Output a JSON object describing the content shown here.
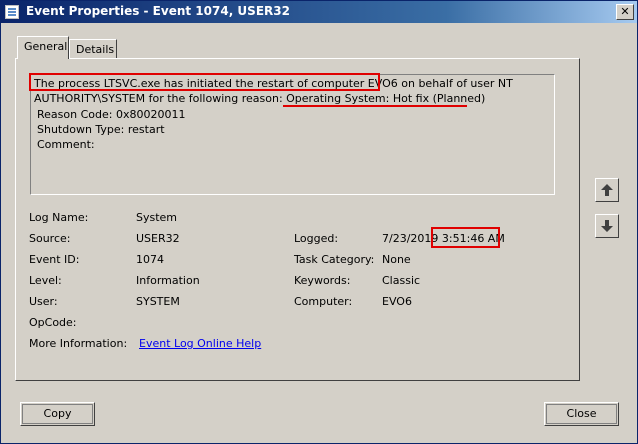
{
  "window": {
    "title": "Event Properties - Event 1074, USER32",
    "close_label": "✕"
  },
  "tabs": [
    {
      "label": "General",
      "active": true
    },
    {
      "label": "Details",
      "active": false
    }
  ],
  "message": {
    "line1_highlight": "The process LTSVC.exe has initiated the restart of computer EVO6",
    "line1_rest": " on behalf of user NT",
    "line2_prefix": "AUTHORITY\\SYSTEM for the following reason: ",
    "line2_reason": "Operating System: Hot fix (Planned)",
    "line3": "Reason Code: 0x80020011",
    "line4": "Shutdown Type: restart",
    "line5": "Comment:"
  },
  "fields": {
    "log_name_label": "Log Name:",
    "log_name_value": "System",
    "source_label": "Source:",
    "source_value": "USER32",
    "logged_label": "Logged:",
    "logged_date": "7/23/2019",
    "logged_time": "3:51:46 AM",
    "event_id_label": "Event ID:",
    "event_id_value": "1074",
    "task_category_label": "Task Category:",
    "task_category_value": "None",
    "level_label": "Level:",
    "level_value": "Information",
    "keywords_label": "Keywords:",
    "keywords_value": "Classic",
    "user_label": "User:",
    "user_value": "SYSTEM",
    "computer_label": "Computer:",
    "computer_value": "EVO6",
    "opcode_label": "OpCode:",
    "opcode_value": "",
    "more_info_label": "More Information:",
    "more_info_link": "Event Log Online Help"
  },
  "buttons": {
    "copy": "Copy",
    "close": "Close"
  },
  "icons": {
    "up": "arrow-up-icon",
    "down": "arrow-down-icon"
  },
  "colors": {
    "highlight": "#e00000",
    "link": "#0000ee",
    "titlebar": "#0a246a"
  }
}
